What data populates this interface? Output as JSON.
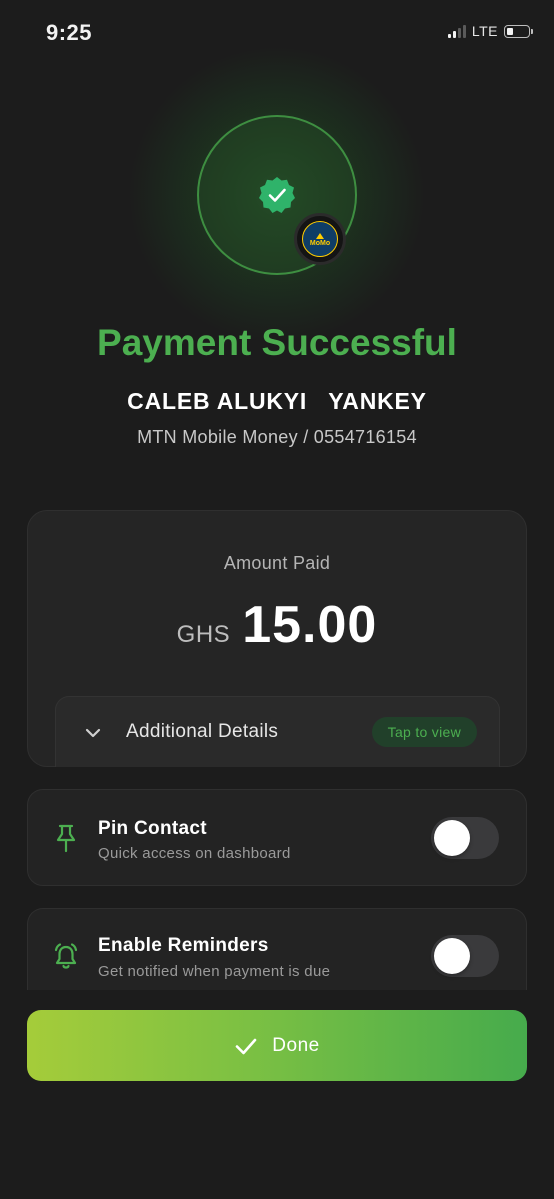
{
  "status_bar": {
    "time": "9:25",
    "network": "LTE"
  },
  "header": {
    "title": "Payment Successful",
    "recipient_name": "CALEB ALUKYI   YANKEY",
    "recipient_account": "MTN Mobile Money / 0554716154",
    "provider_logo_text": "MoMo"
  },
  "amount_card": {
    "label": "Amount Paid",
    "currency": "GHS",
    "amount": "15.00",
    "details_label": "Additional Details",
    "details_action": "Tap to view"
  },
  "options": {
    "pin": {
      "title": "Pin Contact",
      "subtitle": "Quick access on dashboard",
      "icon": "pin-icon",
      "enabled": false
    },
    "reminders": {
      "title": "Enable Reminders",
      "subtitle": "Get notified when payment is due",
      "icon": "bell-icon",
      "enabled": false
    }
  },
  "done_button": {
    "label": "Done",
    "icon": "check-icon"
  },
  "colors": {
    "background": "#1c1c1c",
    "success_green": "#4caf50",
    "card": "#252525",
    "gradient_start": "#a5cc3a",
    "gradient_end": "#46ab4c"
  }
}
